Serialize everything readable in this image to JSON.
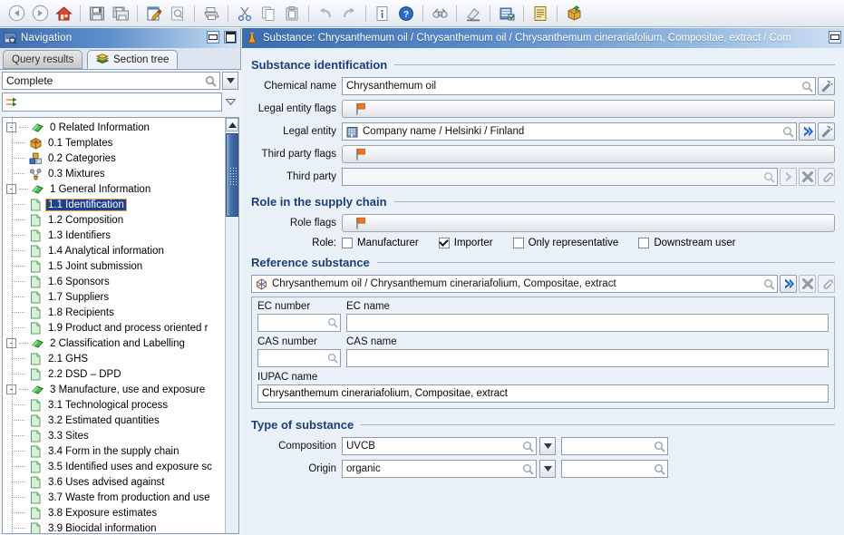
{
  "toolbar": {
    "buttons": [
      {
        "name": "back-icon",
        "title": "Back"
      },
      {
        "name": "forward-icon",
        "title": "Forward"
      },
      {
        "name": "home-icon",
        "title": "Home"
      },
      {
        "name": "save-icon",
        "title": "Save"
      },
      {
        "name": "save-all-icon",
        "title": "Save all"
      },
      {
        "name": "edit-icon",
        "title": "Edit"
      },
      {
        "name": "preview-icon",
        "title": "Preview"
      },
      {
        "name": "print-icon",
        "title": "Print"
      },
      {
        "name": "cut-icon",
        "title": "Cut"
      },
      {
        "name": "copy-icon",
        "title": "Copy"
      },
      {
        "name": "paste-icon",
        "title": "Paste"
      },
      {
        "name": "undo-icon",
        "title": "Undo"
      },
      {
        "name": "redo-icon",
        "title": "Redo"
      },
      {
        "name": "info-icon",
        "title": "Info"
      },
      {
        "name": "help-icon",
        "title": "Help"
      },
      {
        "name": "binoculars-icon",
        "title": "Find"
      },
      {
        "name": "ink-icon",
        "title": "Annotate"
      },
      {
        "name": "database-icon",
        "title": "Database"
      },
      {
        "name": "report-icon",
        "title": "Report"
      },
      {
        "name": "export-package-icon",
        "title": "Export"
      }
    ]
  },
  "navigation": {
    "title": "Navigation",
    "minimize_label": "Minimize",
    "maximize_label": "Maximize",
    "tabs": [
      {
        "label": "Query results",
        "active": false
      },
      {
        "label": "Section tree",
        "active": true
      }
    ],
    "filter": {
      "value": "Complete",
      "placeholder": ""
    },
    "tree": [
      {
        "level": 0,
        "num": "0",
        "label": "0 Related Information",
        "icon": "green-diamond-icon",
        "expander": "-",
        "selected": false
      },
      {
        "level": 1,
        "label": "0.1 Templates",
        "icon": "template-box-icon",
        "selected": false
      },
      {
        "level": 1,
        "label": "0.2 Categories",
        "icon": "categories-icon",
        "selected": false
      },
      {
        "level": 1,
        "label": "0.3 Mixtures",
        "icon": "mixtures-icon",
        "selected": false
      },
      {
        "level": 0,
        "label": "1 General Information",
        "icon": "green-diamond-icon",
        "expander": "-",
        "selected": false
      },
      {
        "level": 1,
        "label": "1.1 Identification",
        "icon": "document-icon",
        "selected": true
      },
      {
        "level": 1,
        "label": "1.2 Composition",
        "icon": "document-icon",
        "selected": false
      },
      {
        "level": 1,
        "label": "1.3 Identifiers",
        "icon": "document-icon",
        "selected": false
      },
      {
        "level": 1,
        "label": "1.4 Analytical information",
        "icon": "document-icon",
        "selected": false
      },
      {
        "level": 1,
        "label": "1.5 Joint submission",
        "icon": "document-icon",
        "selected": false
      },
      {
        "level": 1,
        "label": "1.6 Sponsors",
        "icon": "document-icon",
        "selected": false
      },
      {
        "level": 1,
        "label": "1.7 Suppliers",
        "icon": "document-icon",
        "selected": false
      },
      {
        "level": 1,
        "label": "1.8 Recipients",
        "icon": "document-icon",
        "selected": false
      },
      {
        "level": 1,
        "label": "1.9 Product and process oriented r",
        "icon": "document-icon",
        "selected": false
      },
      {
        "level": 0,
        "label": "2 Classification and Labelling",
        "icon": "green-diamond-icon",
        "expander": "-",
        "selected": false
      },
      {
        "level": 1,
        "label": "2.1 GHS",
        "icon": "document-icon",
        "selected": false
      },
      {
        "level": 1,
        "label": "2.2 DSD – DPD",
        "icon": "document-icon",
        "selected": false
      },
      {
        "level": 0,
        "label": "3 Manufacture, use and exposure",
        "icon": "green-diamond-icon",
        "expander": "-",
        "selected": false
      },
      {
        "level": 1,
        "label": "3.1 Technological process",
        "icon": "document-icon",
        "selected": false
      },
      {
        "level": 1,
        "label": "3.2 Estimated quantities",
        "icon": "document-icon",
        "selected": false
      },
      {
        "level": 1,
        "label": "3.3 Sites",
        "icon": "document-icon",
        "selected": false
      },
      {
        "level": 1,
        "label": "3.4 Form in the supply chain",
        "icon": "document-icon",
        "selected": false
      },
      {
        "level": 1,
        "label": "3.5 Identified uses and exposure sc",
        "icon": "document-icon",
        "selected": false
      },
      {
        "level": 1,
        "label": "3.6 Uses advised against",
        "icon": "document-icon",
        "selected": false
      },
      {
        "level": 1,
        "label": "3.7 Waste from production and use",
        "icon": "document-icon",
        "selected": false
      },
      {
        "level": 1,
        "label": "3.8 Exposure estimates",
        "icon": "document-icon",
        "selected": false
      },
      {
        "level": 1,
        "label": "3.9 Biocidal information",
        "icon": "document-icon",
        "selected": false
      }
    ]
  },
  "main": {
    "title": "Substance: Chrysanthemum oil / Chrysanthemum oil / Chrysanthemum cinerariafolium, Compositae, extract / Com",
    "sections": {
      "substance_identification": {
        "heading": "Substance identification",
        "chemical_name": {
          "label": "Chemical name",
          "value": "Chrysanthemum oil"
        },
        "legal_entity_flags": {
          "label": "Legal entity flags",
          "value": ""
        },
        "legal_entity": {
          "label": "Legal entity",
          "value": "Company name / Helsinki / Finland"
        },
        "third_party_flags": {
          "label": "Third party flags",
          "value": ""
        },
        "third_party": {
          "label": "Third party",
          "value": ""
        }
      },
      "role_in_supply_chain": {
        "heading": "Role in the supply chain",
        "role_flags": {
          "label": "Role flags",
          "value": ""
        },
        "role_label": "Role:",
        "roles": [
          {
            "label": "Manufacturer",
            "checked": false
          },
          {
            "label": "Importer",
            "checked": true
          },
          {
            "label": "Only representative",
            "checked": false
          },
          {
            "label": "Downstream user",
            "checked": false
          }
        ]
      },
      "reference_substance": {
        "heading": "Reference substance",
        "value": "Chrysanthemum oil / Chrysanthemum cinerariafolium, Compositae, extract",
        "ec_number": {
          "label": "EC number",
          "value": ""
        },
        "ec_name": {
          "label": "EC name",
          "value": ""
        },
        "cas_number": {
          "label": "CAS number",
          "value": ""
        },
        "cas_name": {
          "label": "CAS name",
          "value": ""
        },
        "iupac_name": {
          "label": "IUPAC name",
          "value": "Chrysanthemum cinerariafolium, Compositae, extract"
        }
      },
      "type_of_substance": {
        "heading": "Type of substance",
        "composition": {
          "label": "Composition",
          "value": "UVCB",
          "secondary_value": ""
        },
        "origin": {
          "label": "Origin",
          "value": "organic",
          "secondary_value": ""
        }
      }
    }
  },
  "colors": {
    "title_bar_start": "#3b6cb0",
    "panel_bg": "#e9f0f8",
    "section_heading": "#1c3f75",
    "selection_bg": "#1f3f8f",
    "selection_outline": "#e0a33c",
    "flag_orange": "#ef7520"
  }
}
